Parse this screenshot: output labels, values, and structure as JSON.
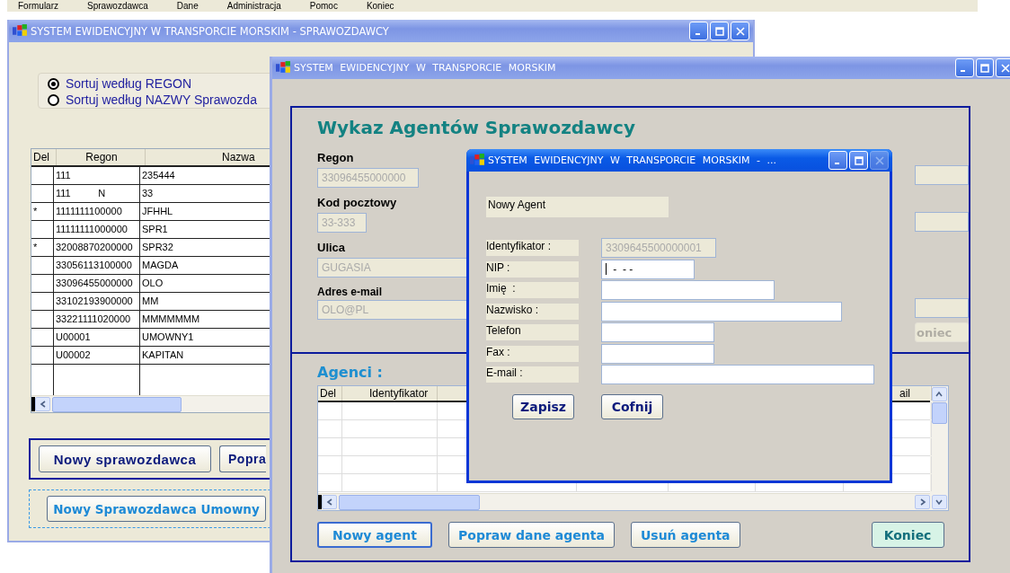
{
  "menu_bar": [
    "Formularz",
    "Sprawozdawca",
    "Dane",
    "Administracja",
    "Pomoc",
    "Koniec"
  ],
  "reporters_window": {
    "title": "SYSTEM EWIDENCYJNY W TRANSPORCIE MORSKIM - SPRAWOZDAWCY",
    "close_disabled": false,
    "sort_options": [
      {
        "label": "Sortuj według REGON",
        "selected": true
      },
      {
        "label": "Sortuj według NAZWY Sprawozda",
        "selected": false
      }
    ],
    "table": {
      "columns": [
        "Del",
        "Regon",
        "Nazwa"
      ],
      "rows": [
        {
          "del": "",
          "regon": "111",
          "name": "235444"
        },
        {
          "del": "",
          "regon": "111          N",
          "name": "33"
        },
        {
          "del": "*",
          "regon": "1111111100000",
          "name": "JFHHL"
        },
        {
          "del": "",
          "regon": "11111111000000",
          "name": "SPR1"
        },
        {
          "del": "*",
          "regon": "32008870200000",
          "name": "SPR32"
        },
        {
          "del": "",
          "regon": "33056113100000",
          "name": "MAGDA"
        },
        {
          "del": "",
          "regon": "33096455000000",
          "name": "OLO"
        },
        {
          "del": "",
          "regon": "33102193900000",
          "name": "MM"
        },
        {
          "del": "",
          "regon": "33221111020000",
          "name": "MMMMMMM"
        },
        {
          "del": "",
          "regon": "U00001",
          "name": "UMOWNY1"
        },
        {
          "del": "",
          "regon": "U00002",
          "name": "KAPITAN"
        }
      ]
    },
    "buttons": [
      "Nowy sprawozdawca",
      "Popra"
    ],
    "contract_button": "Nowy Sprawozdawca Umowny"
  },
  "agents_window": {
    "title": "SYSTEM EWIDENCYJNY W TRANSPORCIE MORSKIM",
    "close_disabled": false,
    "heading": "Wykaz Agentów Sprawozdawcy",
    "fields": [
      {
        "label": "Regon",
        "value": "33096455000000"
      },
      {
        "label": "Kod pocztowy",
        "value": "33-333"
      },
      {
        "label": "Ulica",
        "value": "GUGASIA"
      },
      {
        "label": "Adres e-mail",
        "value": "OLO@PL"
      }
    ],
    "side_button": {
      "label": "oniec",
      "disabled": true
    },
    "agents_label": "Agenci :",
    "table": {
      "columns": [
        "Del",
        "Identyfikator",
        "ail"
      ]
    },
    "buttons": [
      {
        "label": "Nowy agent",
        "kind": "focused"
      },
      {
        "label": "Popraw dane agenta",
        "kind": "normal"
      },
      {
        "label": "Usuń agenta",
        "kind": "normal"
      },
      {
        "label": "Koniec",
        "kind": "exit"
      }
    ]
  },
  "new_agent_dialog": {
    "title": "SYSTEM EWIDENCYJNY W TRANSPORCIE MORSKIM - ...",
    "close_disabled": true,
    "caption": "Nowy Agent",
    "fields": [
      {
        "label": "Identyfikator :",
        "value": "3309645500000001",
        "disabled": true,
        "focused": false
      },
      {
        "label": "NIP :",
        "value": " -  - -",
        "disabled": false,
        "focused": true
      },
      {
        "label": "Imię  :",
        "disabled": false,
        "focused": false
      },
      {
        "label": "Nazwisko :",
        "disabled": false,
        "focused": false
      },
      {
        "label": "Telefon",
        "disabled": false,
        "focused": false
      },
      {
        "label": "Fax :",
        "disabled": false,
        "focused": false
      },
      {
        "label": "E-mail :",
        "disabled": false,
        "focused": false
      }
    ],
    "buttons": [
      "Zapisz",
      "Cofnij"
    ]
  }
}
